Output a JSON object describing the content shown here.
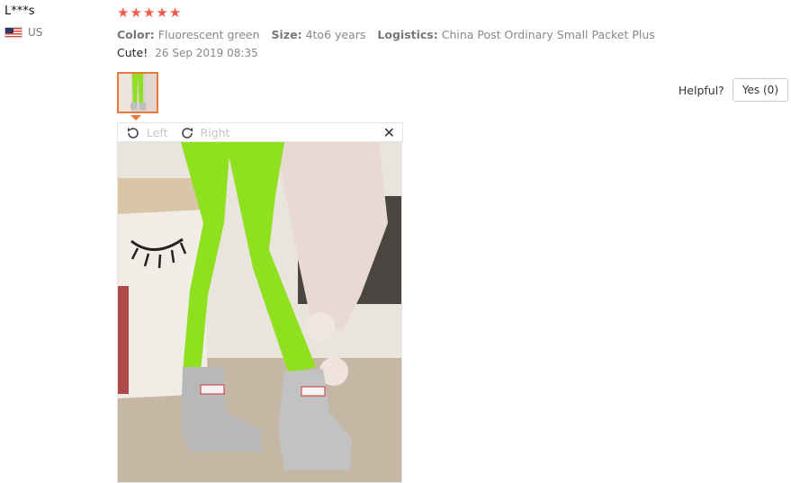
{
  "reviewer": {
    "name": "L***s",
    "country": "US",
    "flag_icon": "us-flag-icon"
  },
  "rating": {
    "stars": 5,
    "max": 5,
    "color": "#f15b4a"
  },
  "attributes": {
    "color_key": "Color:",
    "color_value": "Fluorescent green",
    "size_key": "Size:",
    "size_value": "4to6 years",
    "logistics_key": "Logistics:",
    "logistics_value": "China Post Ordinary Small Packet Plus"
  },
  "comment": {
    "text": "Cute!",
    "date": "26 Sep 2019 08:35"
  },
  "viewer": {
    "rotate_left_label": "Left",
    "rotate_right_label": "Right",
    "close_icon": "close-icon"
  },
  "helpful": {
    "label": "Helpful?",
    "button": "Yes (0)"
  },
  "colors": {
    "accent": "#e8783e",
    "tights": "#8fe01e",
    "boots": "#b8b8b8"
  }
}
